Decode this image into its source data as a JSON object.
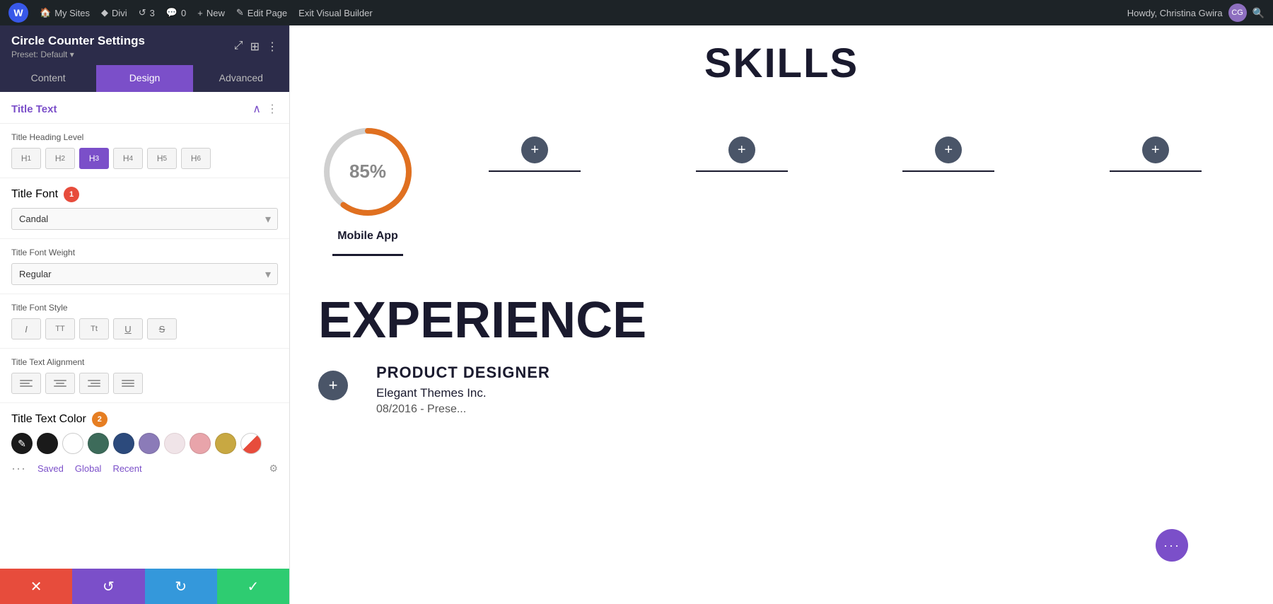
{
  "adminBar": {
    "wpIconLabel": "W",
    "items": [
      {
        "id": "my-sites",
        "icon": "🏠",
        "label": "My Sites"
      },
      {
        "id": "divi",
        "icon": "◆",
        "label": "Divi"
      },
      {
        "id": "updates",
        "icon": "↺",
        "label": "3"
      },
      {
        "id": "comments",
        "icon": "💬",
        "label": "0"
      },
      {
        "id": "new",
        "icon": "+",
        "label": "New"
      },
      {
        "id": "edit-page",
        "icon": "✎",
        "label": "Edit Page"
      },
      {
        "id": "exit-builder",
        "label": "Exit Visual Builder"
      }
    ],
    "userGreeting": "Howdy, Christina Gwira"
  },
  "panel": {
    "title": "Circle Counter Settings",
    "preset": "Preset: Default ▾",
    "tabs": [
      {
        "id": "content",
        "label": "Content"
      },
      {
        "id": "design",
        "label": "Design",
        "active": true
      },
      {
        "id": "advanced",
        "label": "Advanced"
      }
    ],
    "sections": {
      "titleText": {
        "label": "Title Text",
        "headingLevel": {
          "label": "Title Heading Level",
          "options": [
            "H1",
            "H2",
            "H3",
            "H4",
            "H5",
            "H6"
          ],
          "active": "H3"
        },
        "titleFont": {
          "badgeNumber": "1",
          "label": "Title Font",
          "value": "Candal"
        },
        "titleFontWeight": {
          "label": "Title Font Weight",
          "value": "Regular"
        },
        "titleFontStyle": {
          "label": "Title Font Style",
          "buttons": [
            "I",
            "TT",
            "Tt",
            "U",
            "S"
          ]
        },
        "titleTextAlignment": {
          "label": "Title Text Alignment",
          "options": [
            "left",
            "center",
            "right",
            "justify"
          ]
        },
        "titleTextColor": {
          "badgeNumber": "2",
          "label": "Title Text Color",
          "swatches": [
            {
              "id": "picker",
              "color": "#1a1a1a",
              "type": "picker"
            },
            {
              "id": "black",
              "color": "#1a1a1a"
            },
            {
              "id": "white",
              "color": "#ffffff"
            },
            {
              "id": "dark-green",
              "color": "#3d6b5a"
            },
            {
              "id": "dark-blue",
              "color": "#2c4a7c"
            },
            {
              "id": "lavender",
              "color": "#8b7bb8"
            },
            {
              "id": "light-pink",
              "color": "#f0e4e8"
            },
            {
              "id": "pink",
              "color": "#e8a4aa"
            },
            {
              "id": "gold",
              "color": "#c8a842"
            },
            {
              "id": "slash",
              "type": "slash"
            }
          ],
          "footerLinks": [
            "Saved",
            "Global",
            "Recent"
          ]
        }
      }
    }
  },
  "actionBar": {
    "cancel": "✕",
    "reset": "↺",
    "redo": "↻",
    "save": "✓"
  },
  "canvas": {
    "skillsHeading": "SKILLS",
    "circleCounter": {
      "percentage": "85%",
      "label": "Mobile App",
      "barColor": "#e07020",
      "trackColor": "#d0d0d0"
    },
    "experienceHeading": "EXPERIENCE",
    "jobTitle": "PRODUCT DESIGNER",
    "company": "Elegant Themes Inc.",
    "dateRange": "08/2016 - Prese..."
  }
}
